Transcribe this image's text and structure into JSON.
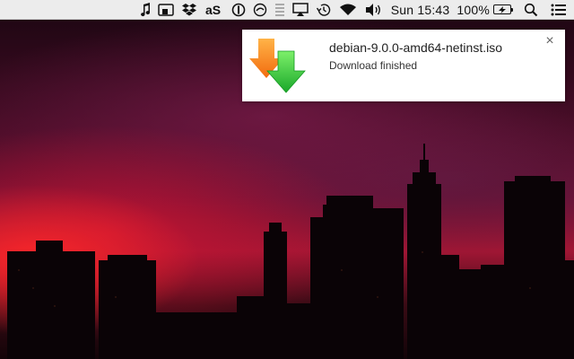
{
  "menubar": {
    "icons": [
      "music-note-icon",
      "screen-mirroring-icon",
      "dropbox-icon",
      "lastfm-icon",
      "one-password-icon",
      "sync-icon",
      "battery-bars-icon",
      "airplay-icon",
      "time-machine-icon",
      "wifi-icon",
      "volume-icon",
      "spotlight-search-icon",
      "notification-center-icon"
    ],
    "clock": "Sun 15:43",
    "battery_percent": "100%"
  },
  "notification": {
    "icon": "download-arrows-icon",
    "title": "debian-9.0.0-amd64-netinst.iso",
    "body": "Download finished",
    "close_label": "×"
  },
  "colors": {
    "menubar_bg": "#ececec",
    "notification_bg": "#ffffff",
    "arrow_orange": "#f7941d",
    "arrow_green": "#2fc83a"
  }
}
